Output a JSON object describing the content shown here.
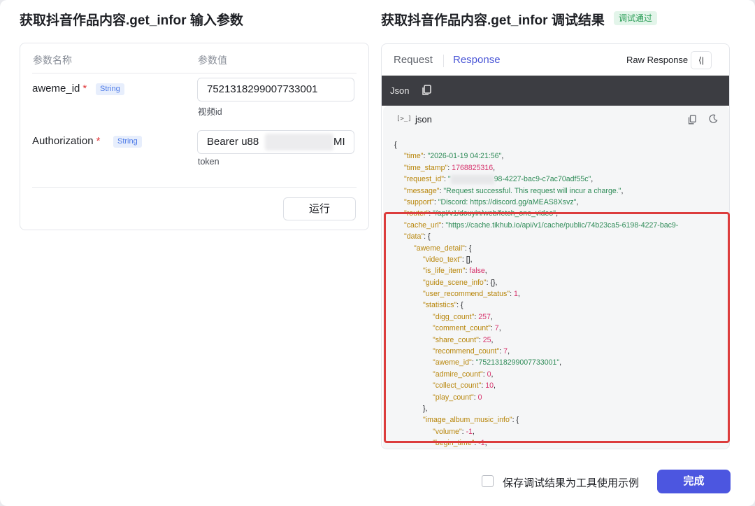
{
  "left_panel": {
    "title": "获取抖音作品内容.get_infor 输入参数",
    "table_headers": {
      "name": "参数名称",
      "value": "参数值"
    },
    "params": [
      {
        "name": "aweme_id",
        "required_mark": "*",
        "type": "String",
        "value": "7521318299007733001",
        "description": "视频id"
      },
      {
        "name": "Authorization",
        "required_mark": "*",
        "type": "String",
        "value": "Bearer u88",
        "value_tail": "MI",
        "description": "token"
      }
    ],
    "run_label": "运行"
  },
  "right_panel": {
    "title": "获取抖音作品内容.get_infor 调试结果",
    "status_badge": "调试通过",
    "tabs": {
      "request": "Request",
      "response": "Response",
      "active": "Response"
    },
    "raw_response_label": "Raw Response",
    "collapse_label": "⟨|",
    "json_bar_label": "Json",
    "code_header_icon": "[>_]",
    "code_header_label": "json",
    "json_lines": {
      "l0": "{",
      "time_k": "\"time\"",
      "time_v": "\"2026-01-19 04:21:56\"",
      "ts_k": "\"time_stamp\"",
      "ts_v": "1768825316",
      "req_k": "\"request_id\"",
      "req_v_start": "\"",
      "req_v_end": "98-4227-bac9-c7ac70adf55c\"",
      "msg_k": "\"message\"",
      "msg_v": "\"Request successful. This request will incur a charge.\"",
      "sup_k": "\"support\"",
      "sup_v": "\"Discord: https://discord.gg/aMEAS8Xsvz\"",
      "router_k": "\"router\"",
      "router_v": "\"/api/v1/douyin/web/fetch_one_video\"",
      "cache_k": "\"cache_url\"",
      "cache_v": "\"https://cache.tikhub.io/api/v1/cache/public/74b23ca5-6198-4227-bac9-",
      "data_k": "\"data\"",
      "ad_k": "\"aweme_detail\"",
      "vt_k": "\"video_text\"",
      "vt_v": "[]",
      "ili_k": "\"is_life_item\"",
      "ili_v": "false",
      "gsi_k": "\"guide_scene_info\"",
      "gsi_v": "{}",
      "urs_k": "\"user_recommend_status\"",
      "urs_v": "1",
      "stats_k": "\"statistics\"",
      "digg_k": "\"digg_count\"",
      "digg_v": "257",
      "comment_k": "\"comment_count\"",
      "comment_v": "7",
      "share_k": "\"share_count\"",
      "share_v": "25",
      "rec_k": "\"recommend_count\"",
      "rec_v": "7",
      "aid_k": "\"aweme_id\"",
      "aid_v": "\"7521318299007733001\"",
      "admire_k": "\"admire_count\"",
      "admire_v": "0",
      "collect_k": "\"collect_count\"",
      "collect_v": "10",
      "play_k": "\"play_count\"",
      "play_v": "0",
      "close_stats": "},",
      "iam_k": "\"image_album_music_info\"",
      "vol_k": "\"volume\"",
      "vol_v": "-1",
      "bt_k": "\"begin_time\"",
      "bt_v": "-1"
    }
  },
  "footer": {
    "save_label": "保存调试结果为工具使用示例",
    "done_label": "完成"
  },
  "colors": {
    "accent": "#4c56e0",
    "pass": "#2a9d56",
    "highlight": "#dc3d3d"
  }
}
